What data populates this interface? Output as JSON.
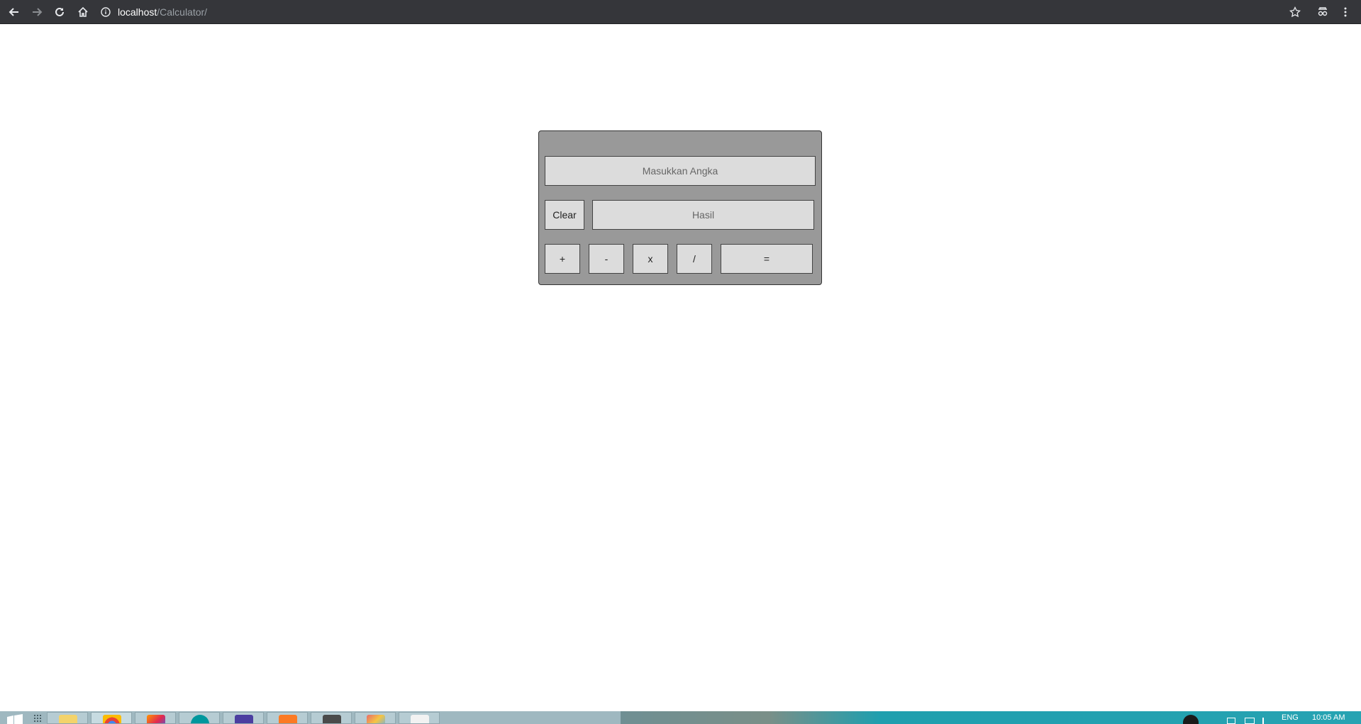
{
  "browser": {
    "url_host": "localhost",
    "url_path": "/Calculator/",
    "icons": [
      "back-icon",
      "forward-icon",
      "reload-icon",
      "home-icon",
      "info-icon",
      "star-icon",
      "extension-icon",
      "menu-icon"
    ]
  },
  "calculator": {
    "input": {
      "placeholder": "Masukkan Angka",
      "value": ""
    },
    "result": {
      "placeholder": "Hasil",
      "value": ""
    },
    "clear_label": "Clear",
    "ops": {
      "plus": "+",
      "minus": "-",
      "times": "x",
      "divide": "/",
      "equals": "="
    }
  },
  "taskbar": {
    "apps": [
      "file-explorer",
      "chrome",
      "firefox",
      "arduino",
      "settings",
      "xampp",
      "sublime-text",
      "paint",
      "notepad"
    ],
    "language": "ENG",
    "time": "10:05 AM"
  }
}
